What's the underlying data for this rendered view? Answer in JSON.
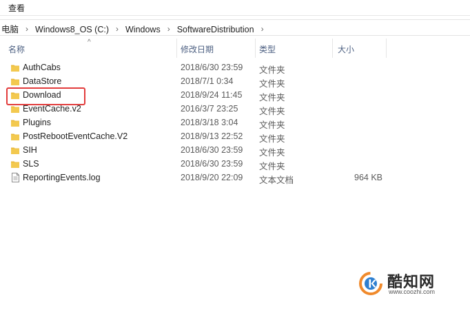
{
  "menubar": {
    "view_label": "查看"
  },
  "address_bar": {
    "crumbs": [
      "电脑",
      "Windows8_OS (C:)",
      "Windows",
      "SoftwareDistribution"
    ]
  },
  "columns": {
    "name": "名称",
    "date_modified": "修改日期",
    "type": "类型",
    "size": "大小"
  },
  "files": [
    {
      "name": "AuthCabs",
      "date": "2018/6/30 23:59",
      "type": "文件夹",
      "size": "",
      "icon": "folder-icon"
    },
    {
      "name": "DataStore",
      "date": "2018/7/1 0:34",
      "type": "文件夹",
      "size": "",
      "icon": "folder-icon"
    },
    {
      "name": "Download",
      "date": "2018/9/24 11:45",
      "type": "文件夹",
      "size": "",
      "icon": "folder-icon"
    },
    {
      "name": "EventCache.v2",
      "date": "2016/3/7 23:25",
      "type": "文件夹",
      "size": "",
      "icon": "folder-icon"
    },
    {
      "name": "Plugins",
      "date": "2018/3/18 3:04",
      "type": "文件夹",
      "size": "",
      "icon": "folder-icon"
    },
    {
      "name": "PostRebootEventCache.V2",
      "date": "2018/9/13 22:52",
      "type": "文件夹",
      "size": "",
      "icon": "folder-icon"
    },
    {
      "name": "SIH",
      "date": "2018/6/30 23:59",
      "type": "文件夹",
      "size": "",
      "icon": "folder-icon"
    },
    {
      "name": "SLS",
      "date": "2018/6/30 23:59",
      "type": "文件夹",
      "size": "",
      "icon": "folder-icon"
    },
    {
      "name": "ReportingEvents.log",
      "date": "2018/9/20 22:09",
      "type": "文本文档",
      "size": "964 KB",
      "icon": "text-file-icon"
    }
  ],
  "watermark": {
    "title": "酷知网",
    "url": "www.coozhi.com"
  },
  "colors": {
    "folder": "#f3c94f",
    "highlight_border": "#e23b3b",
    "header_text": "#4d6082"
  }
}
